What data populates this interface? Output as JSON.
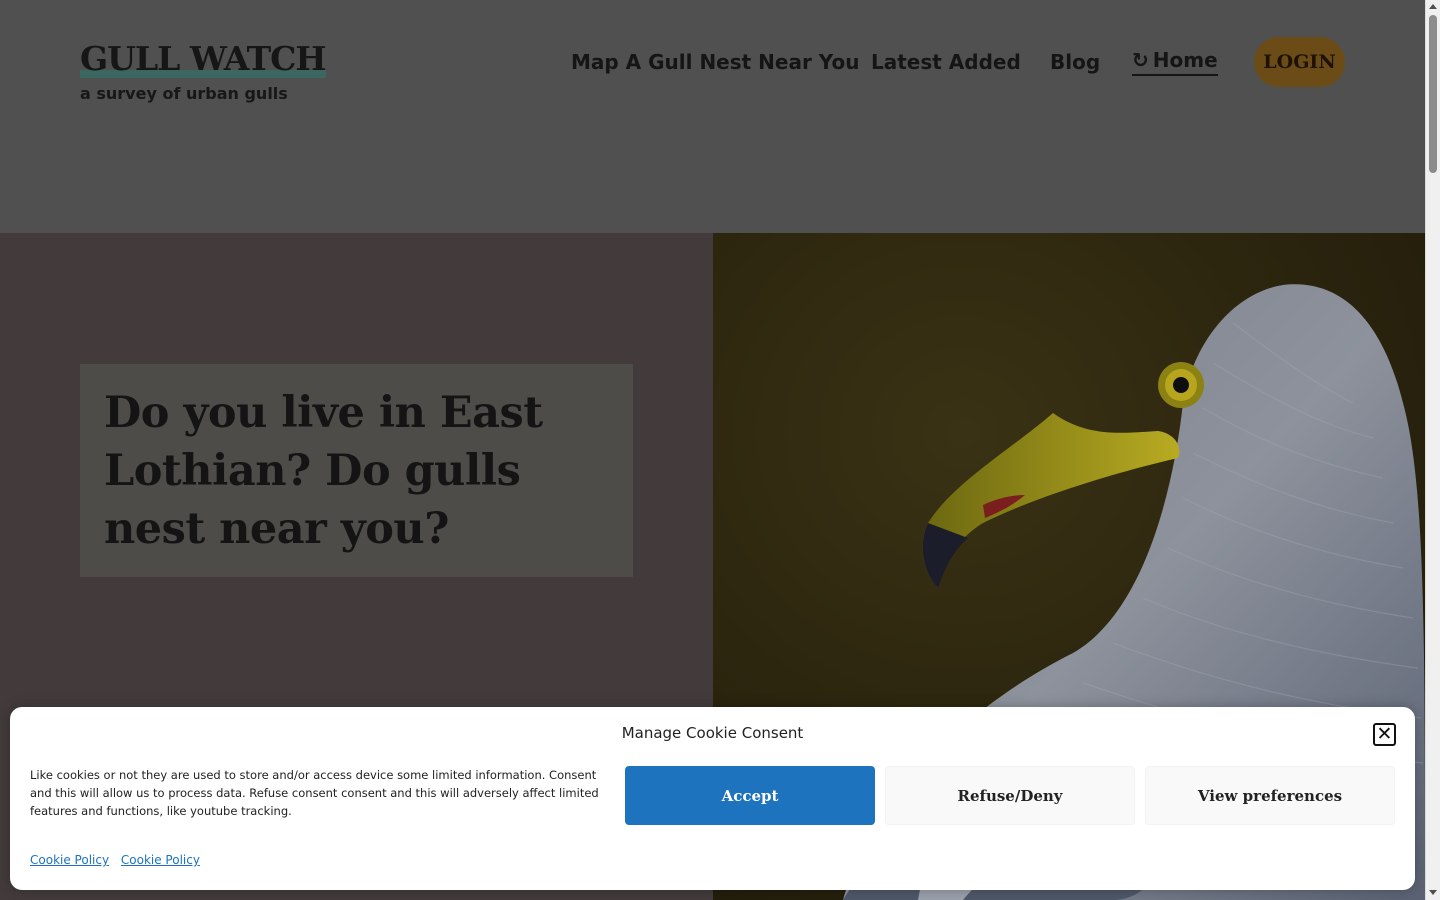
{
  "header": {
    "site_title": "GULL WATCH",
    "tagline": "a survey of urban gulls",
    "nav": [
      {
        "label": "Map A Gull Nest Near You"
      },
      {
        "label": "Latest Added"
      },
      {
        "label": "Blog"
      },
      {
        "label": "Home",
        "icon": "refresh-icon",
        "glyph": "↻"
      }
    ],
    "login_label": "LOGIN"
  },
  "hero": {
    "heading": "Do you live in East Lothian? Do gulls nest near you?",
    "image": "gull-portrait"
  },
  "cookie_banner": {
    "title": "Manage Cookie Consent",
    "text": "Like cookies or not they are used to store and/or access device some limited information. Consent and this will allow us to process data. Refuse consent consent and this will adversely affect limited  features and functions, like youtube tracking.",
    "accept_label": "Accept",
    "refuse_label": "Refuse/Deny",
    "preferences_label": "View preferences",
    "links": [
      "Cookie Policy",
      "Cookie Policy"
    ],
    "close_icon": "close-icon"
  },
  "colors": {
    "accent_blue": "#1e73be",
    "login_brown": "#6b4c16",
    "title_underline": "#3c6660"
  }
}
